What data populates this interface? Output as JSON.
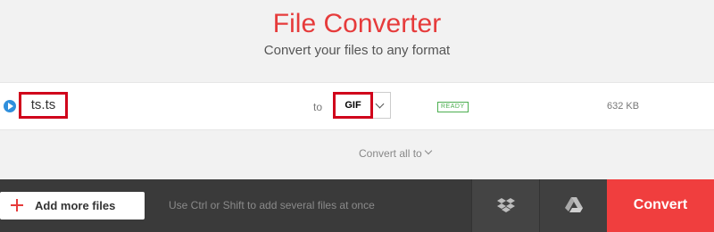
{
  "header": {
    "title": "File Converter",
    "subtitle": "Convert your files to any format"
  },
  "file": {
    "name": "ts.ts",
    "to_label": "to",
    "format": "GIF",
    "status": "READY",
    "size": "632 KB"
  },
  "convert_all": {
    "label": "Convert all to"
  },
  "bottom_bar": {
    "add_label": "Add more files",
    "hint": "Use Ctrl or Shift to add several files at once",
    "convert_label": "Convert"
  },
  "icons": {
    "play": "play-icon",
    "plus": "plus-icon",
    "dropbox": "dropbox-icon",
    "google_drive": "google-drive-icon",
    "chevron": "chevron-down-icon"
  },
  "colors": {
    "accent": "#e63b3b",
    "highlight_box": "#d0021b",
    "ready": "#4caf50",
    "bar": "#3a3a3a"
  }
}
